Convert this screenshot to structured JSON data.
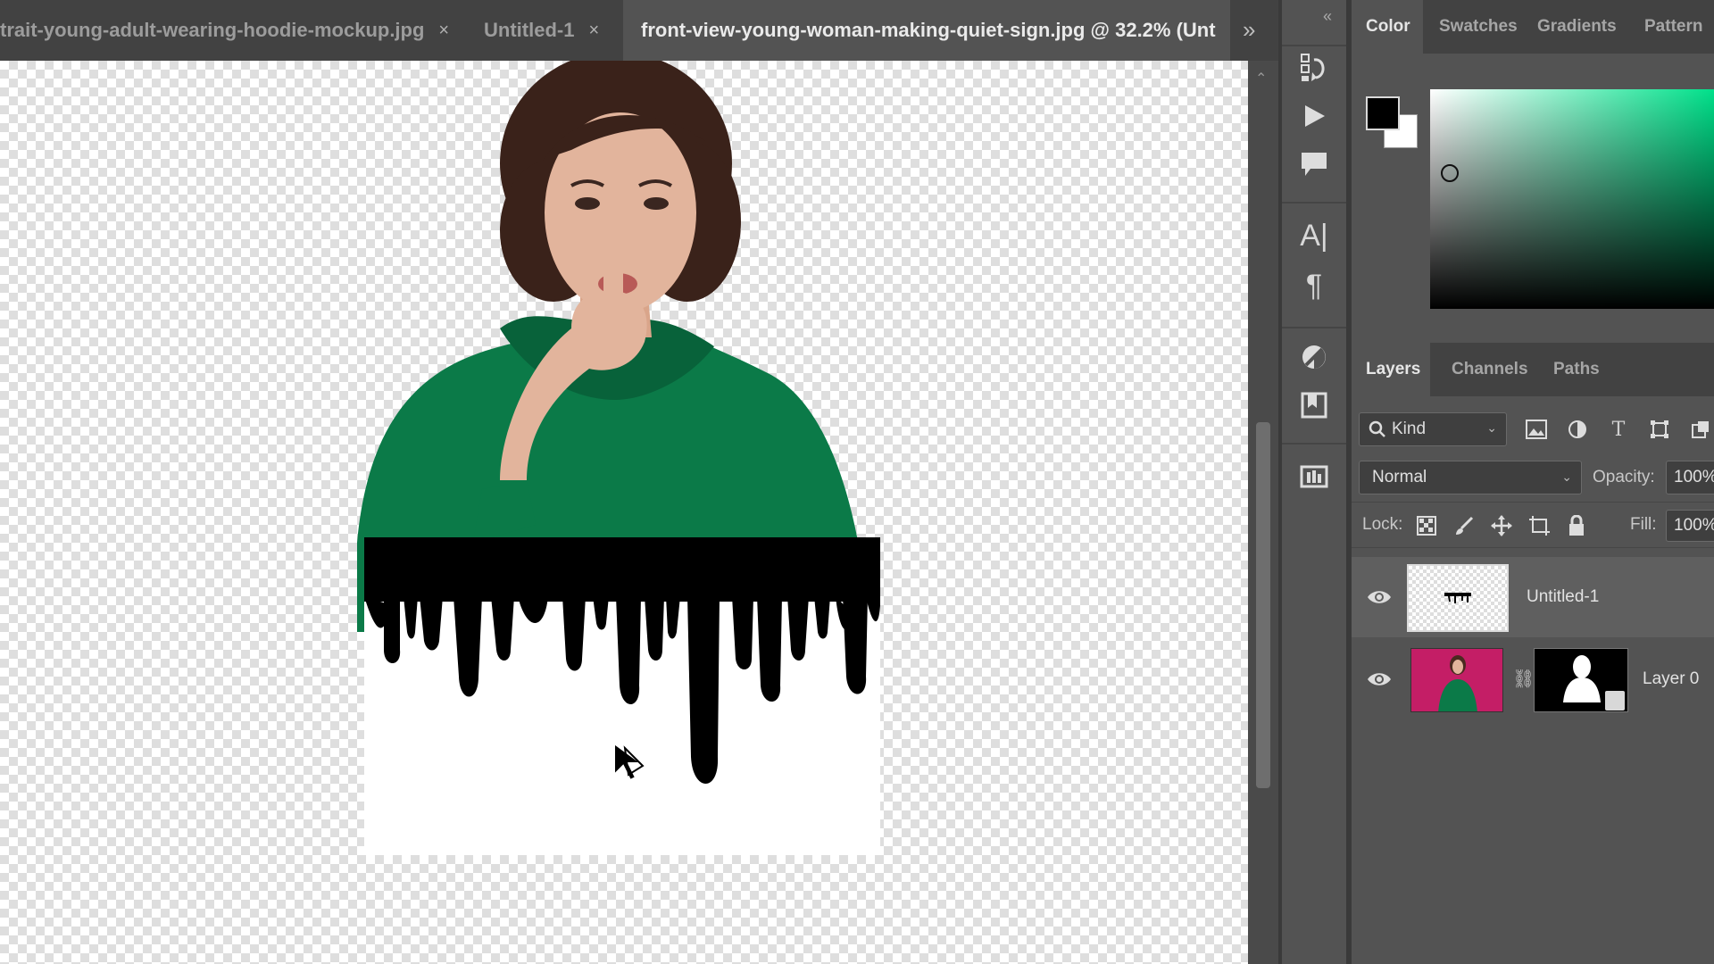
{
  "document_tabs": [
    {
      "label": "trait-young-adult-wearing-hoodie-mockup.jpg",
      "close": "×"
    },
    {
      "label": "Untitled-1",
      "close": "×"
    },
    {
      "label": "front-view-young-woman-making-quiet-sign.jpg @ 32.2% (Unt",
      "close": ""
    }
  ],
  "tab_overflow": "»",
  "tools_collapse": "«",
  "color_panel": {
    "tabs": [
      "Color",
      "Swatches",
      "Gradients",
      "Pattern"
    ],
    "foreground_color": "#000000",
    "background_color": "#ffffff",
    "hue_color": "#00e08a"
  },
  "layers_panel": {
    "tabs": [
      "Layers",
      "Channels",
      "Paths"
    ],
    "filter_kind": "Kind",
    "blend_mode": "Normal",
    "opacity_label": "Opacity:",
    "opacity_value": "100%",
    "lock_label": "Lock:",
    "fill_label": "Fill:",
    "fill_value": "100%",
    "layers": [
      {
        "name": "Untitled-1",
        "visible": true,
        "selected": true
      },
      {
        "name": "Layer 0",
        "visible": true,
        "selected": false,
        "has_mask": true
      }
    ]
  },
  "colors": {
    "hoodie": "#0b7a48",
    "paint": "#000000",
    "photo_bg": "#c41e66"
  }
}
